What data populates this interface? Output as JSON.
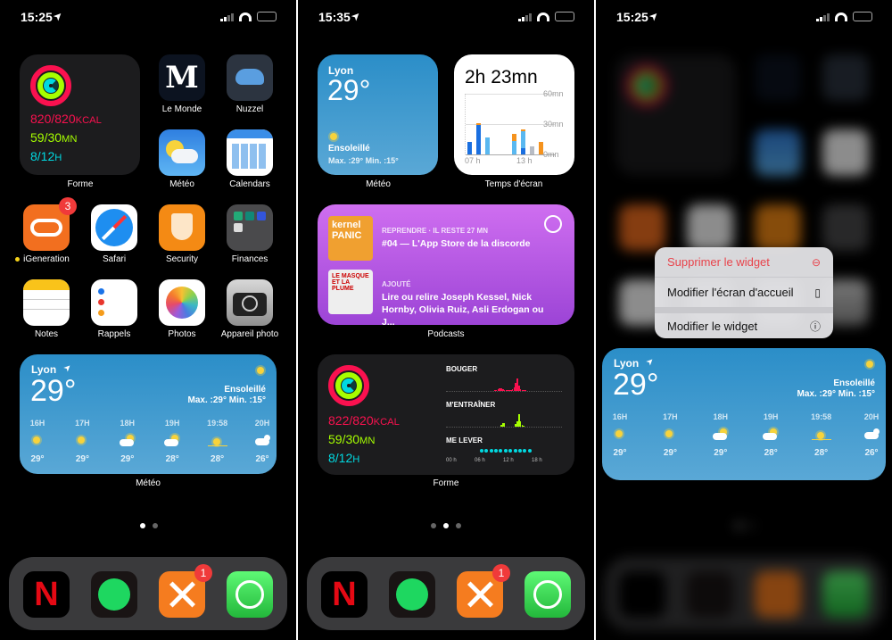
{
  "screens": [
    {
      "time": "15:25"
    },
    {
      "time": "15:35"
    },
    {
      "time": "15:25"
    }
  ],
  "colors": {
    "move": "#fa114f",
    "exercise": "#a6ff00",
    "stand": "#00d9e1",
    "weather_top": "#2b8ec8",
    "podcast": "#b55ae0",
    "badge": "#f03a3a"
  },
  "forme": {
    "label": "Forme",
    "kcal": "820/820",
    "kcal_unit": "KCAL",
    "mn": "59/30",
    "mn_unit": "MN",
    "h": "8/12",
    "h_unit": "H"
  },
  "apps": [
    {
      "label": "Le Monde",
      "icon": "le-monde-icon"
    },
    {
      "label": "Nuzzel",
      "icon": "nuzzel-hedgehog-icon"
    },
    {
      "label": "Météo",
      "icon": "weather-icon"
    },
    {
      "label": "Calendars",
      "icon": "calendar-icon"
    },
    {
      "label": "iGeneration",
      "icon": "igeneration-icon",
      "badge": "3"
    },
    {
      "label": "Safari",
      "icon": "safari-compass-icon"
    },
    {
      "label": "Security",
      "icon": "security-shield-icon"
    },
    {
      "label": "Finances",
      "icon": "folder-icon"
    },
    {
      "label": "Notes",
      "icon": "notes-icon"
    },
    {
      "label": "Rappels",
      "icon": "reminders-icon"
    },
    {
      "label": "Photos",
      "icon": "photos-icon"
    },
    {
      "label": "Appareil photo",
      "icon": "camera-icon"
    }
  ],
  "weather": {
    "label": "Météo",
    "city": "Lyon",
    "temp": "29°",
    "condition": "Ensoleillé",
    "hilo": "Max. :29° Min. :15°",
    "hours": [
      {
        "t": "16H",
        "icon": "sun",
        "temp": "29°"
      },
      {
        "t": "17H",
        "icon": "sun",
        "temp": "29°"
      },
      {
        "t": "18H",
        "icon": "partly-cloudy",
        "temp": "29°"
      },
      {
        "t": "19H",
        "icon": "partly-cloudy",
        "temp": "28°"
      },
      {
        "t": "19:58",
        "icon": "sunset",
        "temp": "28°"
      },
      {
        "t": "20H",
        "icon": "cloudy-night",
        "temp": "26°"
      }
    ]
  },
  "dock": [
    {
      "icon": "netflix-icon"
    },
    {
      "icon": "spotify-icon"
    },
    {
      "icon": "orange-app-icon",
      "badge": "1"
    },
    {
      "icon": "whatsapp-icon"
    }
  ],
  "screentime": {
    "label": "Temps d'écran",
    "total": "2h 23mn",
    "y_ticks": [
      "60mn",
      "30mn",
      "0mn"
    ],
    "x_ticks": [
      "07 h",
      "13 h"
    ],
    "chart_data": {
      "type": "bar",
      "unit": "mn",
      "ylim": [
        0,
        60
      ],
      "bars": [
        {
          "hour": 7,
          "blue": 12,
          "light": 0,
          "orange": 0,
          "gray": 0
        },
        {
          "hour": 8,
          "blue": 29,
          "light": 0,
          "orange": 2,
          "gray": 0
        },
        {
          "hour": 9,
          "blue": 0,
          "light": 17,
          "orange": 0,
          "gray": 0
        },
        {
          "hour": 12,
          "blue": 0,
          "light": 13,
          "orange": 7,
          "gray": 0
        },
        {
          "hour": 13,
          "blue": 6,
          "light": 17,
          "orange": 2,
          "gray": 0
        },
        {
          "hour": 14,
          "blue": 0,
          "light": 0,
          "orange": 0,
          "gray": 8
        },
        {
          "hour": 15,
          "blue": 0,
          "light": 0,
          "orange": 12,
          "gray": 0
        }
      ]
    }
  },
  "podcasts": {
    "label": "Podcasts",
    "items": [
      {
        "kicker": "REPRENDRE · IL RESTE 27 MN",
        "title": "#04 — L'App Store de la discorde",
        "art": "kernel PANIC"
      },
      {
        "kicker": "AJOUTÉ",
        "title": "Lire ou relire Joseph Kessel, Nick Hornby, Olivia Ruiz, Asli Erdogan ou J...",
        "art": "LE MASQUE ET LA PLUME"
      }
    ]
  },
  "forme2": {
    "label": "Forme",
    "kcal": "822/820",
    "kcal_unit": "KCAL",
    "mn": "59/30",
    "mn_unit": "MN",
    "h": "8/12",
    "h_unit": "H",
    "move_title": "BOUGER",
    "exercise_title": "M'ENTRAÎNER",
    "stand_title": "ME LEVER",
    "x_ticks": [
      "00 h",
      "06 h",
      "12 h",
      "18 h"
    ],
    "move": [
      0,
      0,
      0,
      0,
      0,
      0,
      0,
      0,
      0,
      0,
      0,
      0,
      0,
      0,
      0,
      0,
      0,
      0,
      0,
      0,
      0,
      0,
      0,
      0,
      0,
      0,
      0,
      0,
      0,
      0,
      1,
      1,
      2,
      3,
      3,
      2,
      1,
      1,
      1,
      1,
      1,
      2,
      4,
      9,
      14,
      6,
      2,
      1,
      1,
      1,
      0,
      0,
      0,
      0,
      0,
      0,
      0,
      0,
      0,
      0,
      0,
      0,
      0,
      0,
      0,
      0,
      0,
      0,
      0,
      0,
      0,
      0
    ],
    "exercise": [
      0,
      0,
      0,
      0,
      0,
      0,
      0,
      0,
      0,
      0,
      0,
      0,
      0,
      0,
      0,
      0,
      0,
      0,
      0,
      0,
      0,
      0,
      0,
      0,
      0,
      0,
      0,
      0,
      0,
      0,
      0,
      0,
      0,
      0,
      2,
      4,
      4,
      0,
      0,
      0,
      0,
      0,
      0,
      3,
      6,
      14,
      6,
      2,
      1,
      0,
      0,
      0,
      0,
      0,
      0,
      0,
      0,
      0,
      0,
      0,
      0,
      0,
      0,
      0,
      0,
      0,
      0,
      0,
      0,
      0,
      0,
      0
    ],
    "stand_hours": [
      7,
      8,
      9,
      10,
      11,
      12,
      13,
      14,
      15,
      16,
      17
    ]
  },
  "menu": {
    "items": [
      {
        "label": "Supprimer le widget",
        "icon": "minus-circle-icon",
        "destructive": true
      },
      {
        "label": "Modifier l'écran d'accueil",
        "icon": "phone-icon"
      },
      {
        "label": "Modifier le widget",
        "icon": "info-icon"
      }
    ]
  }
}
